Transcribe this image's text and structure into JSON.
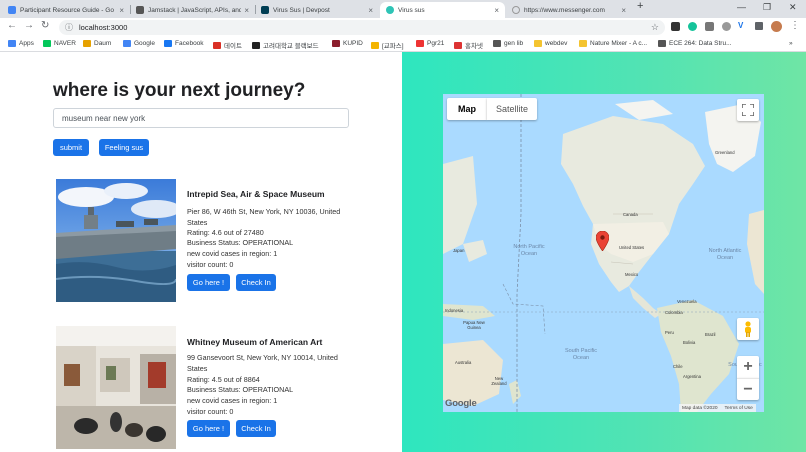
{
  "browser": {
    "tabs": [
      {
        "title": "Participant Resource Guide - Go",
        "color": "#4285f4"
      },
      {
        "title": "Jamstack | JavaScript, APIs, and",
        "color": "#555"
      },
      {
        "title": "Virus Sus | Devpost",
        "color": "#003e54"
      },
      {
        "title": "Virus sus",
        "color": "#2ec4b6"
      },
      {
        "title": "https://www.messenger.com",
        "color": "#999"
      }
    ],
    "active_tab": 3,
    "new_tab": "+",
    "url": "localhost:3000",
    "bookmarks": [
      {
        "label": "Apps",
        "color": "#4285f4"
      },
      {
        "label": "NAVER",
        "color": "#03c75a"
      },
      {
        "label": "Daum",
        "color": "#e6a100"
      },
      {
        "label": "Google",
        "color": "#4285f4"
      },
      {
        "label": "Facebook",
        "color": "#1877f2"
      },
      {
        "label": "데이트",
        "color": "#d93025"
      },
      {
        "label": "고려대학교 블랙보드",
        "color": "#222"
      },
      {
        "label": "KUPID",
        "color": "#8b1e2d"
      },
      {
        "label": "[교파스]",
        "color": "#f4b400"
      },
      {
        "label": "Pgr21",
        "color": "#e33"
      },
      {
        "label": "홍차넷",
        "color": "#d33"
      },
      {
        "label": "gen lib",
        "color": "#555"
      },
      {
        "label": "webdev",
        "color": "#f4c430"
      },
      {
        "label": "Nature Mixer - A c...",
        "color": "#f4c430"
      },
      {
        "label": "ECE 264: Data Stru...",
        "color": "#555"
      }
    ]
  },
  "page": {
    "heading": "where is your next journey?",
    "search_value": "museum near new york",
    "submit_label": "submit",
    "sus_label": "Feeling sus",
    "results": [
      {
        "title": "Intrepid Sea, Air & Space Museum",
        "address": "Pier 86, W 46th St, New York, NY 10036, United States",
        "rating": "Rating: 4.6 out of 27480",
        "status": "Business Status: OPERATIONAL",
        "covid": "new covid cases in region: 1",
        "visitors": "visitor count: 0",
        "go_label": "Go here !",
        "checkin_label": "Check In"
      },
      {
        "title": "Whitney Museum of American Art",
        "address": "99 Gansevoort St, New York, NY 10014, United States",
        "rating": "Rating: 4.5 out of 8864",
        "status": "Business Status: OPERATIONAL",
        "covid": "new covid cases in region: 1",
        "visitors": "visitor count: 0",
        "go_label": "Go here !",
        "checkin_label": "Check In"
      }
    ]
  },
  "map": {
    "type_map": "Map",
    "type_satellite": "Satellite",
    "zoom_in": "+",
    "zoom_out": "−",
    "attribution": "Map data ©2020",
    "terms": "Terms of Use",
    "logo": "Google",
    "ocean_labels": [
      "North Pacific Ocean",
      "North Atlantic Ocean",
      "South Pacific Ocean",
      "South Atlantic Ocean"
    ],
    "place_labels": [
      "Greenland",
      "Canada",
      "United States",
      "Mexico",
      "Japan",
      "Venezuela",
      "Colombia",
      "Peru",
      "Brazil",
      "Bolivia",
      "Chile",
      "Argentina",
      "Papua New Guinea",
      "Australia",
      "New Zealand",
      "Indonesia"
    ]
  }
}
